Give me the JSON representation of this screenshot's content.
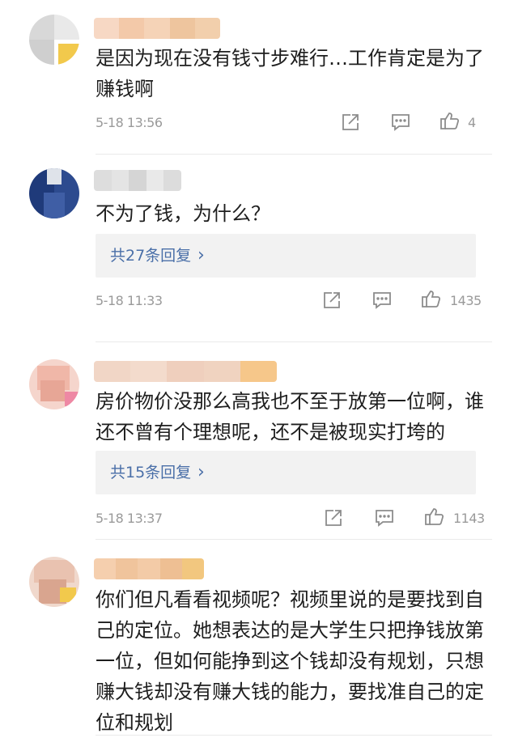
{
  "comments": [
    {
      "text": "是因为现在没有钱寸步难行…工作肯定是为了赚钱啊",
      "time": "5-18 13:56",
      "likes": "4",
      "colors": {
        "avatar": [
          "#d8d8d8",
          "#e9e9e9",
          "#f2c94c",
          "#cfcfcf"
        ],
        "name": [
          "#f7d8c4",
          "#f3c9a9",
          "#f5d3b7",
          "#eec59e",
          "#f2cfac"
        ]
      }
    },
    {
      "text": "不为了钱，为什么？",
      "replies_label": "共27条回复",
      "time": "5-18 11:33",
      "likes": "1435",
      "colors": {
        "avatar": [
          "#1f3a7a",
          "#2d4b8f",
          "#dfe3ea",
          "#3f5ea5"
        ],
        "name": [
          "#dddddd",
          "#e4e4e4",
          "#d5d5d5",
          "#e9e9e9",
          "#dcdcdc"
        ]
      }
    },
    {
      "text": "房价物价没那么高我也不至于放第一位啊，谁还不曾有个理想呢，还不是被现实打垮的",
      "replies_label": "共15条回复",
      "time": "5-18 13:37",
      "likes": "1143",
      "colors": {
        "avatar": [
          "#f0b7a8",
          "#e7a696",
          "#f5d5cc",
          "#ee88a4"
        ],
        "name": [
          "#f1d6c6",
          "#f3dbcc",
          "#efcfbd",
          "#f0d3c0",
          "#f6c78a"
        ]
      }
    },
    {
      "text": "你们但凡看看视频呢？视频里说的是要找到自己的定位。她想表达的是大学生只把挣钱放第一位，但如何能挣到这个钱却没有规划，只想赚大钱却没有赚大钱的能力，要找准自己的定位和规划",
      "colors": {
        "avatar": [
          "#e9c2b0",
          "#d9a58f",
          "#f0d8cc",
          "#f2c94c"
        ],
        "name": [
          "#f5cfae",
          "#f0c49c",
          "#f3cba7",
          "#eebf93",
          "#f2c77f"
        ]
      }
    }
  ],
  "icons": {
    "share": "share-icon",
    "comment": "comment-icon",
    "like": "thumbs-up-icon",
    "chevron": "chevron-right-icon"
  }
}
